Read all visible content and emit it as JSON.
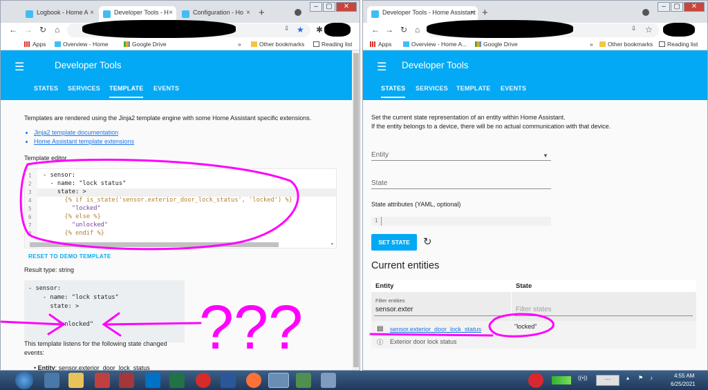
{
  "left_window": {
    "tabs": [
      "Logbook - Home A",
      "Developer Tools - H",
      "Configuration - Ho"
    ],
    "bookmarks": {
      "apps": "Apps",
      "overview": "Overview - Home",
      "drive": "Google Drive",
      "more": "»",
      "other": "Other bookmarks",
      "reading": "Reading list"
    },
    "app_title": "Developer Tools",
    "app_tabs": [
      "STATES",
      "SERVICES",
      "TEMPLATE",
      "EVENTS"
    ],
    "intro": "Templates are rendered using the Jinja2 template engine with some Home Assistant specific extensions.",
    "links": [
      "Jinja2 template documentation",
      "Home Assistant template extensions"
    ],
    "editor_label": "Template editor",
    "code_lines": [
      {
        "n": "1",
        "text": "- sensor:"
      },
      {
        "n": "2",
        "text": "  - name: \"lock status\""
      },
      {
        "n": "3",
        "text": "    state: >"
      },
      {
        "n": "4",
        "text": "      {% if is_state('sensor.exterior_door_lock_status', 'locked') %}"
      },
      {
        "n": "5",
        "text": "        \"locked\""
      },
      {
        "n": "6",
        "text": "      {% else %}"
      },
      {
        "n": "7",
        "text": "        \"unlocked\""
      },
      {
        "n": "8",
        "text": "      {% endif %}"
      }
    ],
    "reset_label": "RESET TO DEMO TEMPLATE",
    "result_type": "Result type: string",
    "result_lines": [
      "- sensor:",
      "    - name: \"lock status\"",
      "      state: >",
      "",
      "        \"unlocked\""
    ],
    "listens": "This template listens for the following state changed",
    "listens2": "events:",
    "entity_label": "Entity",
    "entity_value": "sensor.exterior_door_lock_status"
  },
  "right_window": {
    "tabs": [
      "Developer Tools - Home Assistant"
    ],
    "bookmarks": {
      "apps": "Apps",
      "overview": "Overview - Home A...",
      "drive": "Google Drive",
      "more": "»",
      "other": "Other bookmarks",
      "reading": "Reading list"
    },
    "app_title": "Developer Tools",
    "app_tabs": [
      "STATES",
      "SERVICES",
      "TEMPLATE",
      "EVENTS"
    ],
    "intro1": "Set the current state representation of an entity within Home Assistant.",
    "intro2": "If the entity belongs to a device, there will be no actual communication with that device.",
    "entity_label": "Entity",
    "state_label": "State",
    "attributes_label": "State attributes (YAML, optional)",
    "attr_line": "1",
    "set_state": "SET STATE",
    "current_entities": "Current entities",
    "col_entity": "Entity",
    "col_state": "State",
    "filter_entities_label": "Filter entities",
    "filter_entities_value": "sensor.exter",
    "filter_states_placeholder": "Filter states",
    "row_entity": "sensor.exterior_door_lock_status",
    "row_state": "\"locked\"",
    "row_friendly": "Exterior door lock status"
  },
  "annotations": {
    "question_marks": "???"
  },
  "taskbar": {
    "time": "4:55 AM",
    "date": "6/25/2021"
  },
  "colors": {
    "accent": "#03a9f4",
    "annotation": "#ff00ff"
  }
}
